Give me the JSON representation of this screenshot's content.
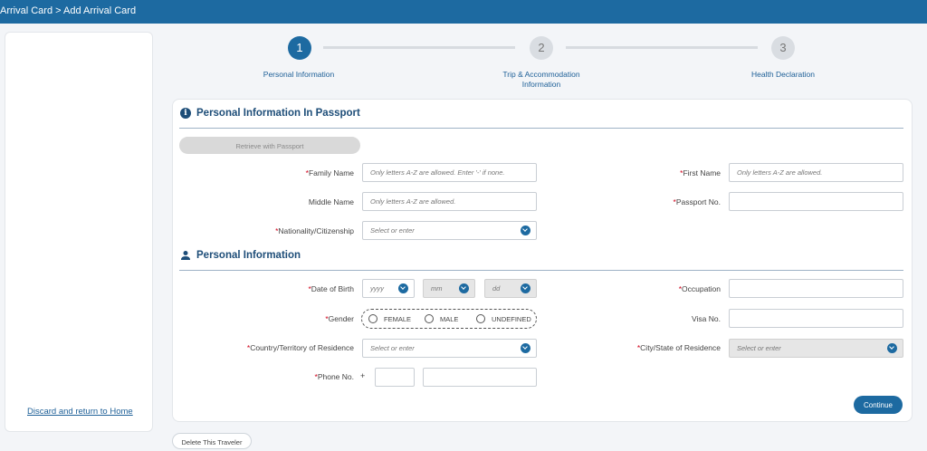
{
  "header": {
    "breadcrumb": "Arrival Card > Add Arrival Card"
  },
  "sidebar": {
    "discard_link": "Discard and return to Home"
  },
  "stepper": {
    "steps": [
      {
        "number": "1",
        "label": "Personal Information"
      },
      {
        "number": "2",
        "label": "Trip & Accommodation Information"
      },
      {
        "number": "3",
        "label": "Health Declaration"
      }
    ]
  },
  "passport_section": {
    "title": "Personal Information In Passport",
    "retrieve_button": "Retrieve with Passport",
    "family_name": {
      "label": "Family Name",
      "placeholder": "Only letters A-Z are allowed. Enter '-' if none."
    },
    "first_name": {
      "label": "First Name",
      "placeholder": "Only letters A-Z are allowed."
    },
    "middle_name": {
      "label": "Middle Name",
      "placeholder": "Only letters A-Z are allowed."
    },
    "passport_no": {
      "label": "Passport No.",
      "placeholder": ""
    },
    "nationality": {
      "label": "Nationality/Citizenship",
      "placeholder": "Select or enter"
    }
  },
  "personal_section": {
    "title": "Personal Information",
    "dob": {
      "label": "Date of Birth",
      "year": "yyyy",
      "month": "mm",
      "day": "dd"
    },
    "occupation": {
      "label": "Occupation"
    },
    "gender": {
      "label": "Gender",
      "options": [
        "FEMALE",
        "MALE",
        "UNDEFINED"
      ]
    },
    "visa": {
      "label": "Visa No."
    },
    "country": {
      "label": "Country/Territory of Residence",
      "placeholder": "Select or enter"
    },
    "city": {
      "label": "City/State of Residence",
      "placeholder": "Select or enter"
    },
    "phone": {
      "label": "Phone No.",
      "prefix": "+"
    }
  },
  "actions": {
    "continue": "Continue",
    "delete_traveler": "Delete This Traveler"
  },
  "colors": {
    "primary": "#1d6aa1",
    "required": "#d0021b"
  }
}
